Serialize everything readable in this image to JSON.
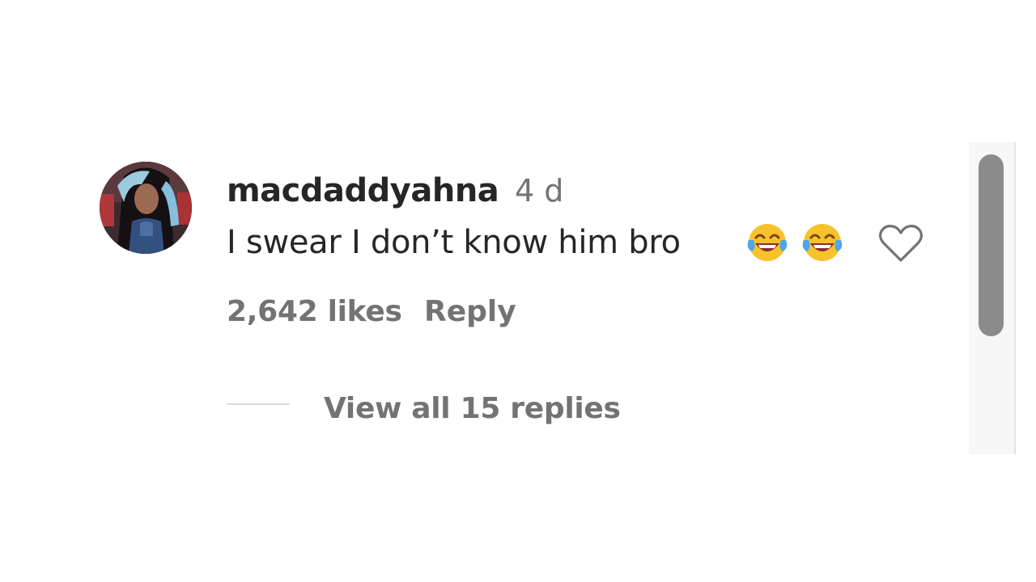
{
  "comment": {
    "username": "macdaddyahna",
    "timestamp": "4 d",
    "text": "I swear I don’t know him bro",
    "emojis": [
      "face-with-tears-of-joy-icon",
      "face-with-tears-of-joy-icon"
    ],
    "likes_label": "2,642 likes",
    "reply_label": "Reply",
    "view_replies_label": "View all 15 replies",
    "like_icon": "heart-outline-icon",
    "liked": false
  },
  "colors": {
    "primary_text": "#262626",
    "secondary_text": "#737373",
    "emoji_face": "#f8c22a",
    "emoji_tears": "#4fa6e8",
    "scrollbar_thumb": "#8b8b8b"
  }
}
